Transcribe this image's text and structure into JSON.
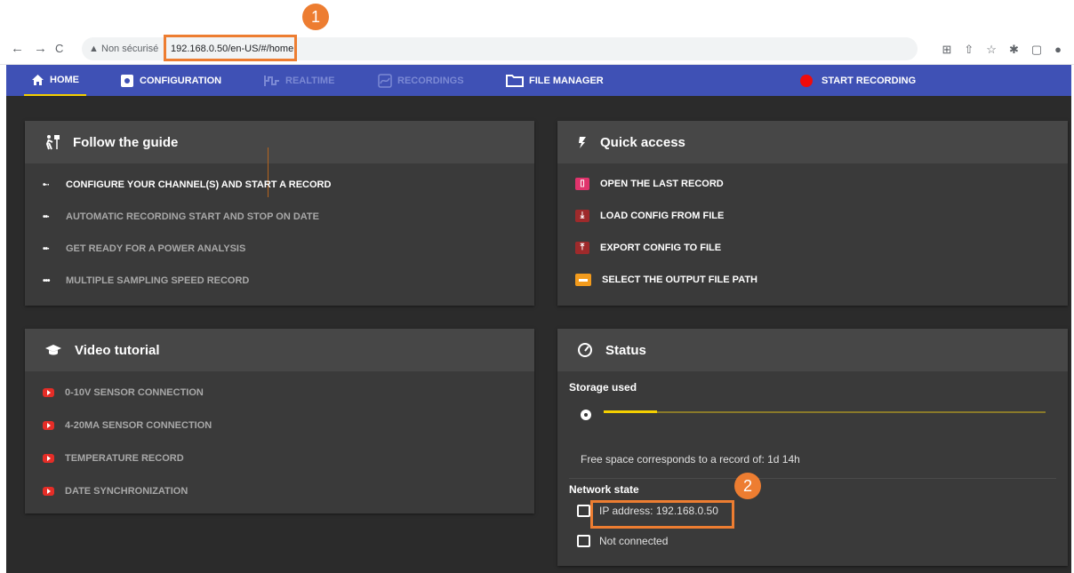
{
  "browser": {
    "back": "←",
    "forward": "→",
    "reload": "C",
    "warning": "▲",
    "security": "Non sécurisé",
    "url": "192.168.0.50/en-US/#/home"
  },
  "callouts": {
    "one": "1",
    "two": "2"
  },
  "nav": {
    "home": "HOME",
    "configuration": "CONFIGURATION",
    "realtime": "REALTIME",
    "recordings": "RECORDINGS",
    "file_manager": "FILE MANAGER",
    "start_recording": "START RECORDING"
  },
  "guide": {
    "title": "Follow the guide",
    "items": [
      "CONFIGURE YOUR CHANNEL(S) AND START A RECORD",
      "AUTOMATIC RECORDING START AND STOP ON DATE",
      "GET READY FOR A POWER ANALYSIS",
      "MULTIPLE SAMPLING SPEED RECORD"
    ]
  },
  "quick": {
    "title": "Quick access",
    "items": [
      "OPEN THE LAST RECORD",
      "LOAD CONFIG FROM FILE",
      "EXPORT CONFIG TO FILE",
      "SELECT THE OUTPUT FILE PATH"
    ]
  },
  "video": {
    "title": "Video tutorial",
    "items": [
      "0-10V SENSOR CONNECTION",
      "4-20MA SENSOR CONNECTION",
      "TEMPERATURE RECORD",
      "DATE SYNCHRONIZATION"
    ]
  },
  "status": {
    "title": "Status",
    "storage_label": "Storage used",
    "storage_used_fraction": 0.12,
    "free_space": "Free space corresponds to a record of: 1d 14h",
    "network_label": "Network state",
    "ip": "IP address: 192.168.0.50",
    "connection": "Not connected"
  },
  "colors": {
    "nav_bg": "#3f51b5",
    "accent_yellow": "#f5d000",
    "highlight": "#ed7d31",
    "record_red": "#f10b0b"
  }
}
